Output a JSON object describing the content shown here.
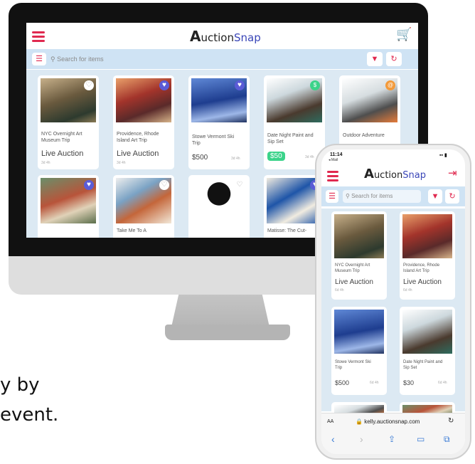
{
  "app": {
    "logo_letter": "A",
    "logo_word1": "uction",
    "logo_word2": "Snap",
    "search_placeholder": "Search for items",
    "accent_color": "#e0294f",
    "brand_color": "#3a46b8"
  },
  "desktop": {
    "items": [
      {
        "title_line1": "NYC Overnight Art",
        "title_line2": "Museum Trip",
        "status": "Live Auction",
        "time": "3d 4h",
        "favorited": false
      },
      {
        "title_line1": "Providence, Rhode",
        "title_line2": "Island Art Trip",
        "status": "Live Auction",
        "time": "3d 4h",
        "favorited": true
      },
      {
        "title_line1": "Stowe Vermont Ski",
        "title_line2": "Trip",
        "status": "$500",
        "time": "3d 4h",
        "favorited": true
      },
      {
        "title_line1": "Date Night Paint and",
        "title_line2": "Sip Set",
        "status": "$50",
        "time": "3d 4h",
        "favorited": false
      },
      {
        "title_line1": "Outdoor Adventure",
        "title_line2": "",
        "status": "",
        "time": "",
        "favorited": false
      },
      {
        "title_line1": "",
        "title_line2": "",
        "favorited": true
      },
      {
        "title_line1": "Take Me To A",
        "title_line2": "",
        "favorited": false
      },
      {
        "title_line1": "",
        "title_line2": "",
        "favorited": false
      },
      {
        "title_line1": "Matisse: The Cut-",
        "title_line2": "",
        "favorited": true
      }
    ]
  },
  "phone": {
    "time": "11:14",
    "carrier": "◂ Mail",
    "items": [
      {
        "title_line1": "NYC Overnight Art",
        "title_line2": "Museum Trip",
        "status": "Live Auction",
        "time": "6d 4h"
      },
      {
        "title_line1": "Providence, Rhode",
        "title_line2": "Island Art Trip",
        "status": "Live Auction",
        "time": "6d 4h"
      },
      {
        "title_line1": "Stowe Vermont Ski",
        "title_line2": "Trip",
        "status": "$500",
        "time": "6d 4h"
      },
      {
        "title_line1": "Date Night Paint and",
        "title_line2": "Sip Set",
        "status": "$30",
        "time": "6d 4h"
      }
    ],
    "safari_aa": "AA",
    "safari_url": "kelly.auctionsnap.com"
  },
  "caption": {
    "line1": "y by",
    "line2": "event."
  },
  "icons": {
    "menu": "hamburger-icon",
    "cart": "cart-icon",
    "search": "search-icon",
    "list": "list-icon",
    "filter": "filter-icon",
    "refresh": "refresh-icon",
    "heart": "heart-icon",
    "login": "login-icon"
  }
}
